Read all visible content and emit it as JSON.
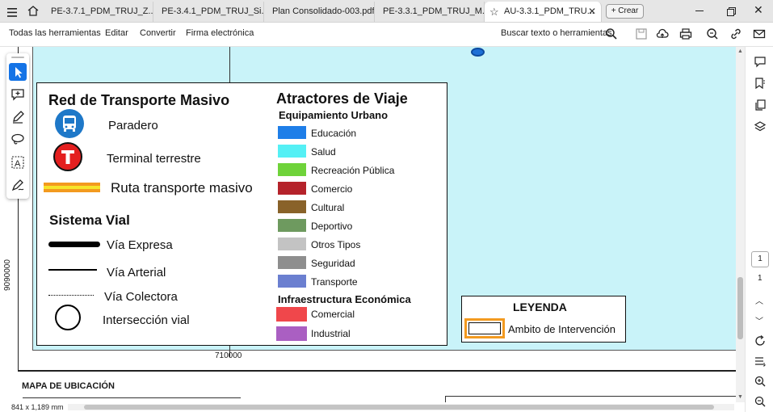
{
  "tabs": [
    {
      "label": "PE-3.7.1_PDM_TRUJ_Z..."
    },
    {
      "label": "PE-3.4.1_PDM_TRUJ_Si..."
    },
    {
      "label": "Plan Consolidado-003.pdf"
    },
    {
      "label": "PE-3.3.1_PDM_TRUJ_M..."
    },
    {
      "label": "AU-3.3.1_PDM_TRU..."
    }
  ],
  "new_tab_label": "+ Crear",
  "menu": {
    "all_tools": "Todas las herramientas",
    "edit": "Editar",
    "convert": "Convertir",
    "esign": "Firma electrónica"
  },
  "search_label": "Buscar texto o herramientas",
  "map": {
    "coord_y": "9090000",
    "coord_x": "710000",
    "section_title": "MAPA DE UBICACIÓN"
  },
  "legend": {
    "transport_title": "Red de Transporte Masivo",
    "stop": "Paradero",
    "terminal": "Terminal terrestre",
    "route": "Ruta transporte masivo",
    "road_title": "Sistema Vial",
    "express": "Vía Expresa",
    "arterial": "Vía Arterial",
    "collector": "Vía Colectora",
    "intersection": "Intersección vial",
    "attractors_title": "Atractores de Viaje",
    "urban_title": "Equipamiento Urbano",
    "urban_items": [
      {
        "label": "Educación",
        "color": "#1e7ee8"
      },
      {
        "label": "Salud",
        "color": "#55f0f5"
      },
      {
        "label": "Recreación Pública",
        "color": "#6fd33a"
      },
      {
        "label": "Comercio",
        "color": "#b5232b"
      },
      {
        "label": "Cultural",
        "color": "#896229"
      },
      {
        "label": "Deportivo",
        "color": "#6e9a5f"
      },
      {
        "label": "Otros Tipos",
        "color": "#c3c3c3"
      },
      {
        "label": "Seguridad",
        "color": "#8e8e8e"
      },
      {
        "label": "Transporte",
        "color": "#6b7fd0"
      }
    ],
    "econ_title": "Infraestructura Económica",
    "econ_items": [
      {
        "label": "Comercial",
        "color": "#f0474b"
      },
      {
        "label": "Industrial",
        "color": "#aa5fc2"
      }
    ],
    "key_title": "LEYENDA",
    "key_item": "Ambito de Intervención"
  },
  "page_current": "1",
  "page_total": "1",
  "page_size": "841 x 1,189 mm",
  "colors": {
    "map_bg": "#c9f3f9",
    "accent": "#1473e6"
  }
}
